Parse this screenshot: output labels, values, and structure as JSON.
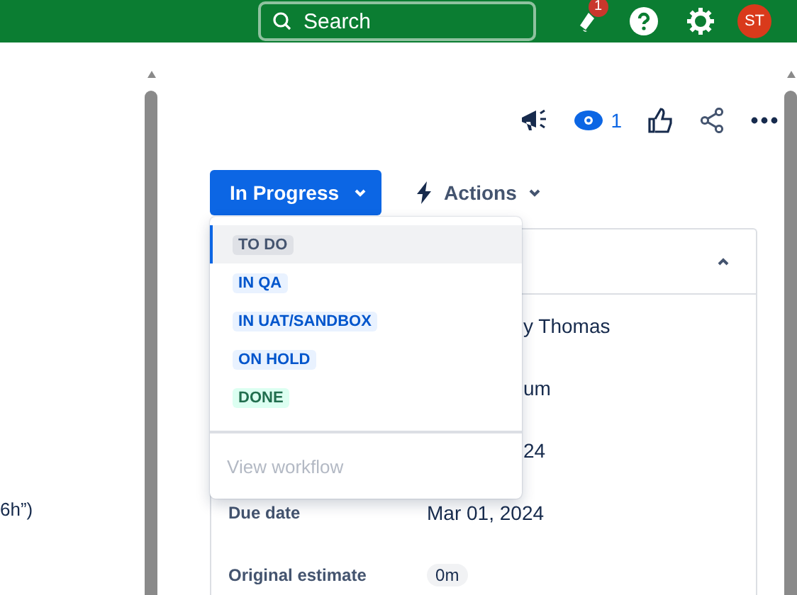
{
  "top_bar": {
    "search": {
      "placeholder": "Search"
    },
    "notifications_badge": "1",
    "avatar": "ST"
  },
  "left_pane": {
    "text_fragment": "6h”)"
  },
  "issue_toolbar": {
    "watchers": "1"
  },
  "status_button": {
    "label": "In Progress"
  },
  "actions_button": {
    "label": "Actions"
  },
  "status_menu": {
    "items": [
      {
        "label": "TO DO",
        "kind": "todo",
        "selected": true
      },
      {
        "label": "IN QA",
        "kind": "progress",
        "selected": false
      },
      {
        "label": "IN UAT/SANDBOX",
        "kind": "progress",
        "selected": false
      },
      {
        "label": "ON HOLD",
        "kind": "progress",
        "selected": false
      },
      {
        "label": "DONE",
        "kind": "done",
        "selected": false
      }
    ],
    "footer": {
      "label": "View workflow",
      "disabled": true
    }
  },
  "details": {
    "rows": [
      {
        "value": "y Thomas",
        "kind": "partial"
      },
      {
        "value": "um",
        "kind": "partial"
      },
      {
        "value": "24",
        "kind": "partial"
      },
      {
        "label": "Due date",
        "value": "Mar 01, 2024",
        "kind": "text"
      },
      {
        "label": "Original estimate",
        "value": "0m",
        "kind": "lozenge"
      }
    ]
  }
}
